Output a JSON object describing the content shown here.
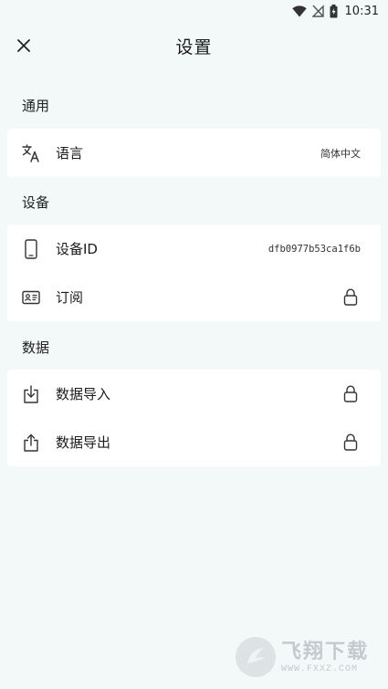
{
  "status_bar": {
    "time": "10:31"
  },
  "header": {
    "title": "设置"
  },
  "sections": {
    "general": {
      "title": "通用",
      "language": {
        "label": "语言",
        "value": "简体中文"
      }
    },
    "device": {
      "title": "设备",
      "device_id": {
        "label": "设备ID",
        "value": "dfb0977b53ca1f6b"
      },
      "subscription": {
        "label": "订阅"
      }
    },
    "data": {
      "title": "数据",
      "import": {
        "label": "数据导入"
      },
      "export": {
        "label": "数据导出"
      }
    }
  },
  "watermark": {
    "main": "飞翔下载",
    "sub": "WWW.FXXZ.COM"
  },
  "icons": {
    "close": "close-icon",
    "language": "translate-icon",
    "device_id": "phone-icon",
    "subscription": "id-card-icon",
    "import": "import-icon",
    "export": "export-icon",
    "lock": "lock-icon"
  },
  "colors": {
    "background": "#f3f8f8",
    "card": "#ffffff",
    "text": "#1c1c1c"
  }
}
